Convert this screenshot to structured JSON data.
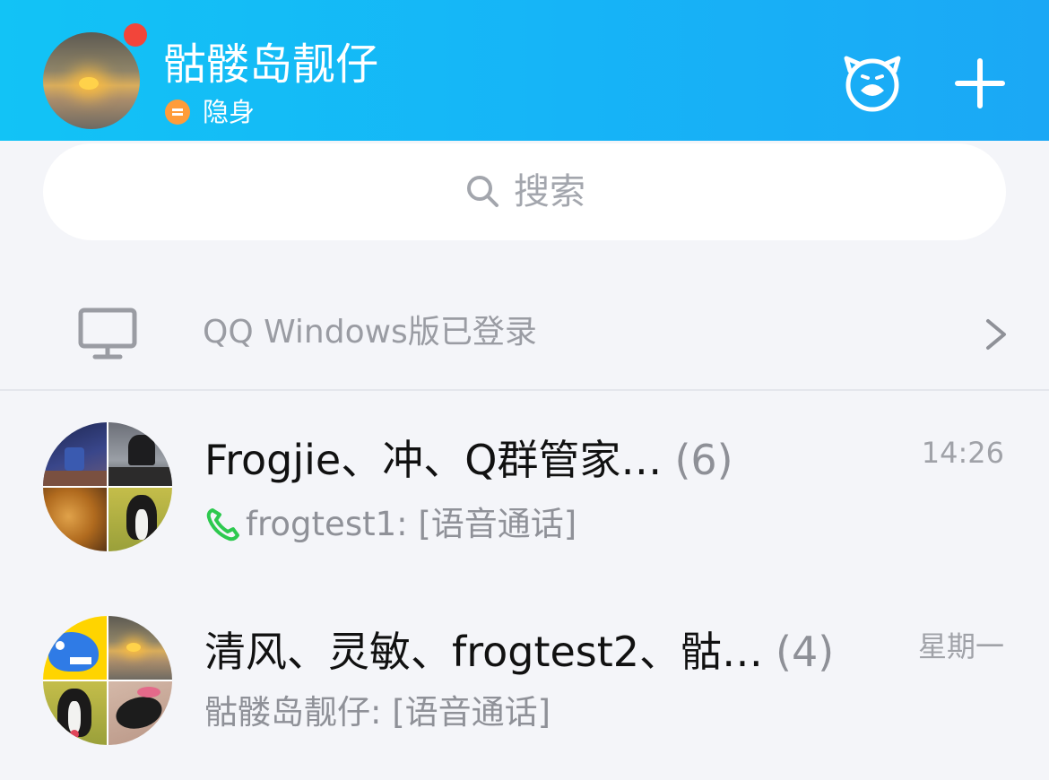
{
  "header": {
    "nickname": "骷髅岛靓仔",
    "status": "隐身",
    "status_color": "#ff9c3a",
    "notification_dot_color": "#f2453a",
    "background_color": "#16b4f7",
    "right_icons": [
      "mascot-icon",
      "plus-icon"
    ]
  },
  "search": {
    "placeholder": "搜索",
    "icon": "search-icon"
  },
  "device_login": {
    "icon": "monitor-icon",
    "text": "QQ Windows版已登录",
    "action_icon": "chevron-right-icon"
  },
  "chats": [
    {
      "title": "Frogjie、冲、Q群管家…",
      "count": "(6)",
      "time": "14:26",
      "preview_icon": "phone-icon",
      "preview": "frogtest1: [语音通话]"
    },
    {
      "title": "清风、灵敏、frogtest2、骷…",
      "count": "(4)",
      "time": "星期一",
      "preview": "骷髅岛靓仔: [语音通话]"
    }
  ]
}
